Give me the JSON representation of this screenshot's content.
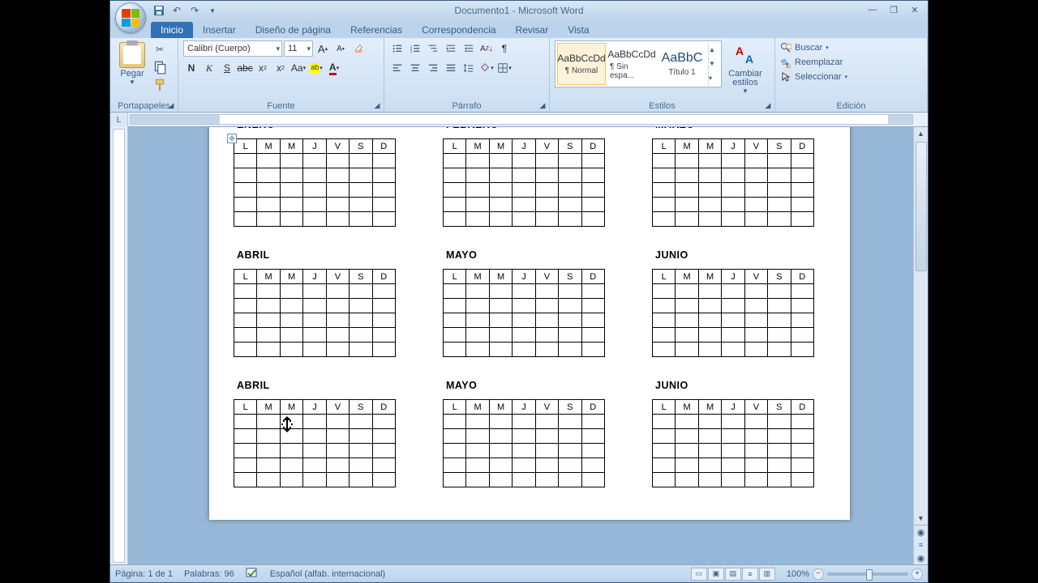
{
  "title": "Documento1 - Microsoft Word",
  "tabs": [
    "Inicio",
    "Insertar",
    "Diseño de página",
    "Referencias",
    "Correspondencia",
    "Revisar",
    "Vista"
  ],
  "active_tab": 0,
  "clipboard": {
    "paste": "Pegar",
    "group": "Portapapeles"
  },
  "font": {
    "group": "Fuente",
    "name": "Calibri (Cuerpo)",
    "size": "11"
  },
  "paragraph": {
    "group": "Párrafo"
  },
  "styles": {
    "group": "Estilos",
    "change": "Cambiar estilos",
    "items": [
      {
        "preview": "AaBbCcDd",
        "name": "¶ Normal",
        "selected": true
      },
      {
        "preview": "AaBbCcDd",
        "name": "¶ Sin espa...",
        "selected": false
      },
      {
        "preview": "AaBbC",
        "name": "Título 1",
        "selected": false,
        "big": true
      }
    ]
  },
  "editing": {
    "group": "Edición",
    "find": "Buscar",
    "replace": "Reemplazar",
    "select": "Seleccionar"
  },
  "ruler_corner": "L",
  "months_row1": [
    "ENERO",
    "FEBRERO",
    "MARZO"
  ],
  "months_row2": [
    "ABRIL",
    "MAYO",
    "JUNIO"
  ],
  "months_row3": [
    "ABRIL",
    "MAYO",
    "JUNIO"
  ],
  "day_headers": [
    "L",
    "M",
    "M",
    "J",
    "V",
    "S",
    "D"
  ],
  "status": {
    "page": "Página: 1 de 1",
    "words": "Palabras: 96",
    "lang": "Español (alfab. internacional)",
    "zoom": "100%"
  }
}
